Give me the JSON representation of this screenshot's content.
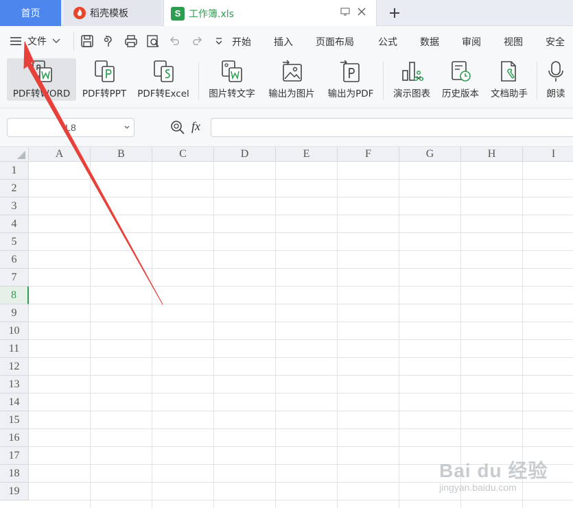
{
  "tabs": {
    "home": "首页",
    "template": "稻壳模板",
    "workbook": "工作簿.xls",
    "add_symbol": "+"
  },
  "menu": {
    "file": "文件",
    "items": [
      "开始",
      "插入",
      "页面布局",
      "公式",
      "数据",
      "审阅",
      "视图",
      "安全"
    ]
  },
  "ribbon": {
    "buttons": [
      {
        "label": "PDF转WORD",
        "icon": "pdf-to-word-icon"
      },
      {
        "label": "PDF转PPT",
        "icon": "pdf-to-ppt-icon"
      },
      {
        "label": "PDF转Excel",
        "icon": "pdf-to-excel-icon"
      },
      {
        "label": "图片转文字",
        "icon": "image-to-text-icon"
      },
      {
        "label": "输出为图片",
        "icon": "export-image-icon"
      },
      {
        "label": "输出为PDF",
        "icon": "export-pdf-icon"
      },
      {
        "label": "演示图表",
        "icon": "chart-icon"
      },
      {
        "label": "历史版本",
        "icon": "history-icon"
      },
      {
        "label": "文档助手",
        "icon": "doc-assistant-icon"
      },
      {
        "label": "朗读",
        "icon": "microphone-icon"
      }
    ]
  },
  "formula": {
    "namebox": "L8",
    "fx": "fx",
    "value": ""
  },
  "grid": {
    "columns": [
      "A",
      "B",
      "C",
      "D",
      "E",
      "F",
      "G",
      "H",
      "I"
    ],
    "rows": [
      "1",
      "2",
      "3",
      "4",
      "5",
      "6",
      "7",
      "8",
      "9",
      "10",
      "11",
      "12",
      "13",
      "14",
      "15",
      "16",
      "17",
      "18",
      "19"
    ],
    "active_row": "8"
  },
  "watermark": {
    "main": "Bai du 经验",
    "sub": "jingyan.baidu.com"
  },
  "colors": {
    "accent_blue": "#4d86ec",
    "spreadsheet_green": "#2e9d52",
    "annotation_red": "#e8413a"
  }
}
